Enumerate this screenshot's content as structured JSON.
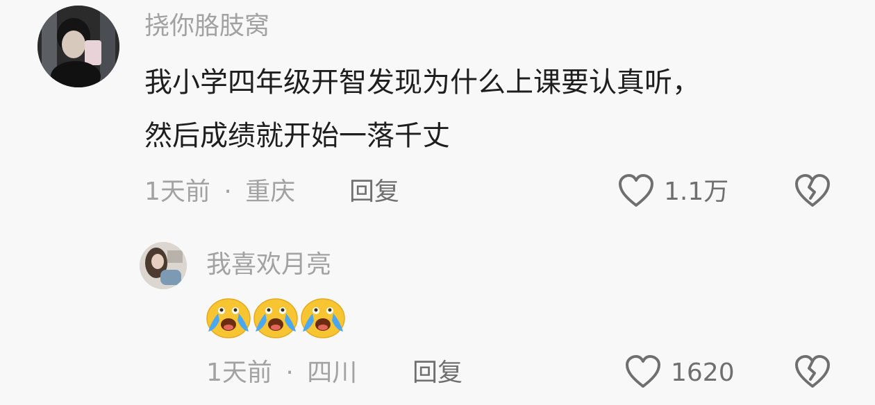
{
  "comment": {
    "username": "挠你胳肢窝",
    "text_line1": "我小学四年级开智发现为什么上课要认真听，",
    "text_line2": "然后成绩就开始一落千丈",
    "time": "1天前",
    "separator": "·",
    "location": "重庆",
    "reply_label": "回复",
    "likes": "1.1万"
  },
  "reply": {
    "username": "我喜欢月亮",
    "emojis": [
      "cry-laugh-emoji",
      "cry-laugh-emoji",
      "cry-laugh-emoji"
    ],
    "time": "1天前",
    "separator": "·",
    "location": "四川",
    "reply_label": "回复",
    "likes": "1620"
  },
  "icons": {
    "like": "heart-outline-icon",
    "dislike": "broken-heart-icon"
  }
}
